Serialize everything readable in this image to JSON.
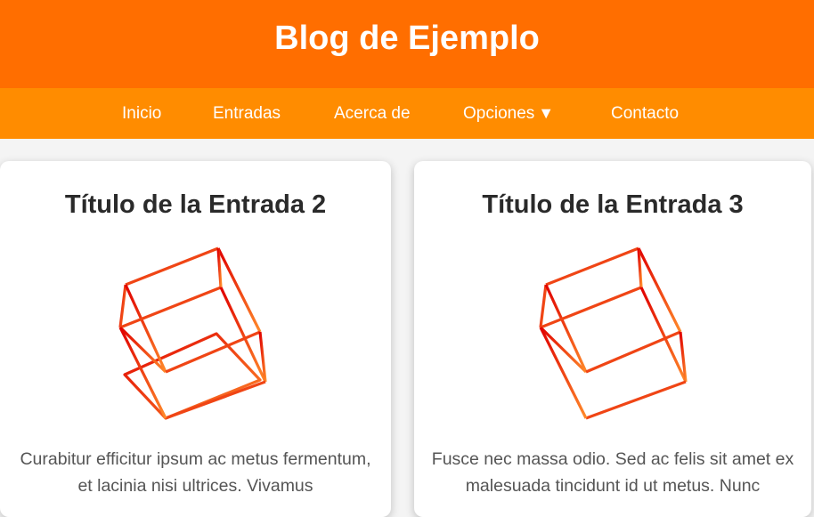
{
  "header": {
    "title": "Blog de Ejemplo"
  },
  "nav": {
    "items": [
      {
        "label": "Inicio"
      },
      {
        "label": "Entradas"
      },
      {
        "label": "Acerca de"
      },
      {
        "label": "Opciones",
        "caret": "▼"
      },
      {
        "label": "Contacto"
      }
    ]
  },
  "posts": [
    {
      "title": "Título de la Entrada 2",
      "image_icon": "cube-wireframe-icon",
      "text": "Curabitur efficitur ipsum ac metus fermentum, et lacinia nisi ultrices. Vivamus"
    },
    {
      "title": "Título de la Entrada 3",
      "image_icon": "cube-wireframe-icon",
      "text": "Fusce nec massa odio. Sed ac felis sit amet ex malesuada tincidunt id ut metus. Nunc"
    }
  ],
  "colors": {
    "header_bg": "#ff6e00",
    "nav_bg": "#ff8c00",
    "cube_gradient_start": "#e00000",
    "cube_gradient_end": "#ff8a2a"
  }
}
